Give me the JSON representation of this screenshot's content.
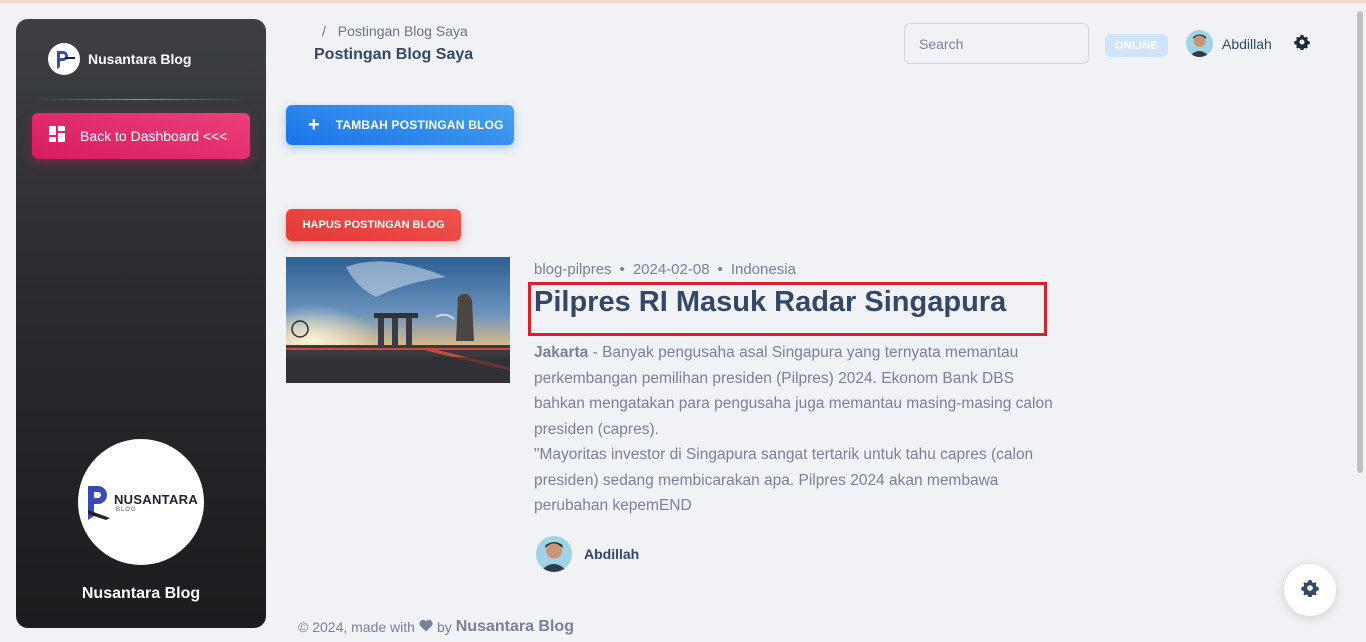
{
  "sidebar": {
    "brand_name": "Nusantara Blog",
    "nav_active_label": "Back to Dashboard <<<",
    "logo_text": "NUSANTARA",
    "logo_subtext": "BLOG",
    "footer_name": "Nusantara Blog"
  },
  "header": {
    "breadcrumb_separator": "/",
    "breadcrumb_current": "Postingan Blog Saya",
    "page_title": "Postingan Blog Saya",
    "search_placeholder": "Search",
    "status_badge": "ONLINE",
    "user_name": "Abdillah"
  },
  "actions": {
    "add_label": "TAMBAH POSTINGAN BLOG",
    "delete_label": "HAPUS POSTINGAN BLOG"
  },
  "post": {
    "category": "blog-pilpres",
    "date": "2024-02-08",
    "country": "Indonesia",
    "meta_separator": "•",
    "title": "Pilpres RI Masuk Radar Singapura",
    "excerpt_lead": "Jakarta",
    "excerpt_body": " - Banyak pengusaha asal Singapura yang ternyata memantau perkembangan pemilihan presiden (Pilpres) 2024. Ekonom Bank DBS bahkan mengatakan para pengusaha juga memantau masing-masing calon presiden (capres).",
    "excerpt_quote": "\"Mayoritas investor di Singapura sangat tertarik untuk tahu capres (calon presiden) sedang membicarakan apa. Pilpres 2024 akan membawa perubahan kepemEND",
    "author": "Abdillah"
  },
  "footer": {
    "prefix": "© 2024, made with",
    "by": "by",
    "brand": "Nusantara Blog"
  },
  "colors": {
    "primary_blue": "#1a73e8",
    "danger_red": "#e53935",
    "pink": "#d81b60",
    "highlight_red": "#d9202b"
  }
}
